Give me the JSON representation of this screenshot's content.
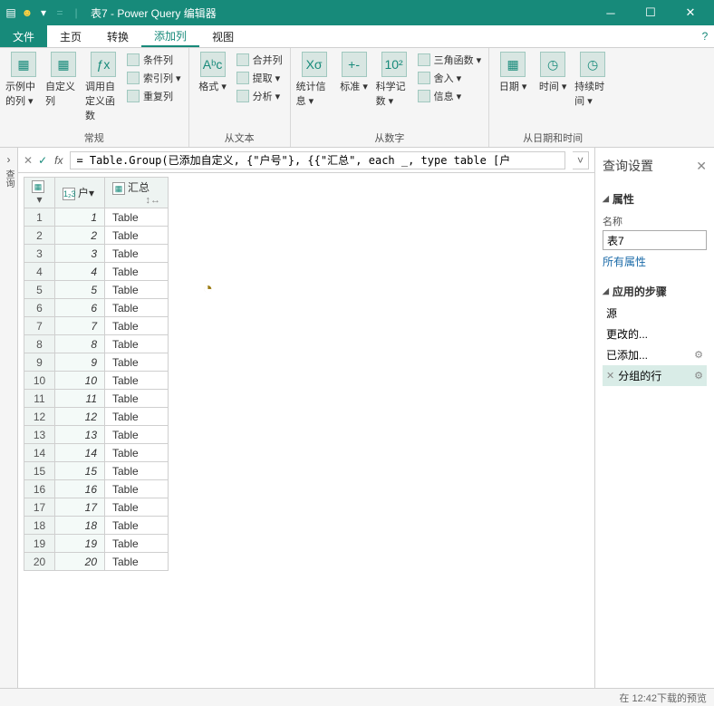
{
  "titlebar": {
    "title": "表7 - Power Query 编辑器"
  },
  "tabs": {
    "file": "文件",
    "home": "主页",
    "transform": "转换",
    "addcol": "添加列",
    "view": "视图"
  },
  "ribbon": {
    "g1": {
      "b1": "示例中的列 ▾",
      "b2": "自定义列",
      "b3": "调用自定义函数",
      "s1": "条件列",
      "s2": "索引列 ▾",
      "s3": "重复列",
      "label": "常规"
    },
    "g2": {
      "b1": "格式 ▾",
      "s1": "合并列",
      "s2": "提取 ▾",
      "s3": "分析 ▾",
      "label": "从文本"
    },
    "g3": {
      "b1": "统计信息 ▾",
      "b2": "标准 ▾",
      "b3": "科学记数 ▾",
      "s1": "三角函数 ▾",
      "s2": "舍入 ▾",
      "s3": "信息 ▾",
      "label": "从数字"
    },
    "g4": {
      "b1": "日期 ▾",
      "b2": "时间 ▾",
      "b3": "持续时间 ▾",
      "label": "从日期和时间"
    }
  },
  "fx": {
    "formula": "= Table.Group(已添加自定义, {\"户号\"}, {{\"汇总\", each _, type table [户"
  },
  "cols": {
    "hu": "户▾",
    "hz": "汇总",
    "huicon": "1₂3",
    "hzicon": "▦"
  },
  "rows": [
    {
      "n": "1",
      "hu": "1",
      "hz": "Table"
    },
    {
      "n": "2",
      "hu": "2",
      "hz": "Table"
    },
    {
      "n": "3",
      "hu": "3",
      "hz": "Table"
    },
    {
      "n": "4",
      "hu": "4",
      "hz": "Table"
    },
    {
      "n": "5",
      "hu": "5",
      "hz": "Table"
    },
    {
      "n": "6",
      "hu": "6",
      "hz": "Table"
    },
    {
      "n": "7",
      "hu": "7",
      "hz": "Table"
    },
    {
      "n": "8",
      "hu": "8",
      "hz": "Table"
    },
    {
      "n": "9",
      "hu": "9",
      "hz": "Table"
    },
    {
      "n": "10",
      "hu": "10",
      "hz": "Table"
    },
    {
      "n": "11",
      "hu": "11",
      "hz": "Table"
    },
    {
      "n": "12",
      "hu": "12",
      "hz": "Table"
    },
    {
      "n": "13",
      "hu": "13",
      "hz": "Table"
    },
    {
      "n": "14",
      "hu": "14",
      "hz": "Table"
    },
    {
      "n": "15",
      "hu": "15",
      "hz": "Table"
    },
    {
      "n": "16",
      "hu": "16",
      "hz": "Table"
    },
    {
      "n": "17",
      "hu": "17",
      "hz": "Table"
    },
    {
      "n": "18",
      "hu": "18",
      "hz": "Table"
    },
    {
      "n": "19",
      "hu": "19",
      "hz": "Table"
    },
    {
      "n": "20",
      "hu": "20",
      "hz": "Table"
    }
  ],
  "side": {
    "title": "查询设置",
    "prop_h": "属性",
    "name_l": "名称",
    "name_v": "表7",
    "allprops": "所有属性",
    "steps_h": "应用的步骤",
    "steps": {
      "s0": "源",
      "s1": "更改的...",
      "s2": "已添加...",
      "s3": "分组的行"
    }
  },
  "status": {
    "left": "",
    "right": "在 12:42下载的预览"
  }
}
